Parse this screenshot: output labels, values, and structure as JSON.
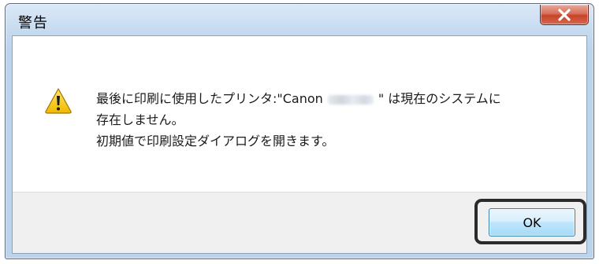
{
  "window": {
    "title": "警告"
  },
  "icons": {
    "close": "close-icon",
    "warning": "warning-icon"
  },
  "message": {
    "line1_before": "最後に印刷に使用したプリンタ:\"Canon",
    "line1_after": "\" は現在のシステムに",
    "line2": "存在しません。",
    "line3": "初期値で印刷設定ダイアログを開きます。"
  },
  "buttons": {
    "ok_label": "OK"
  },
  "colors": {
    "close_button": "#c7432a",
    "ok_button": "#bee6fd",
    "warning_yellow": "#f5c400",
    "highlight_border": "#2b2b2b"
  }
}
